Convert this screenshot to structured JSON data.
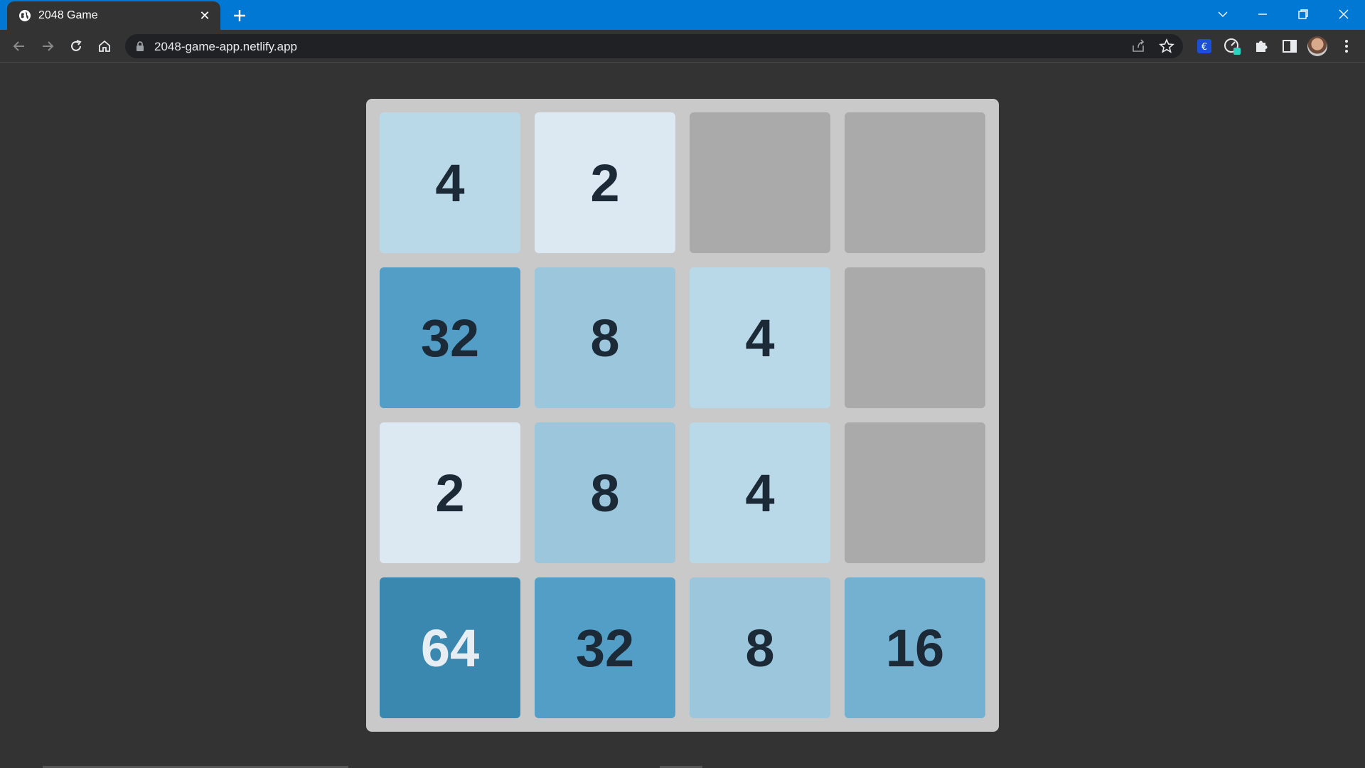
{
  "browser": {
    "tab_title": "2048 Game",
    "url": "2048-game-app.netlify.app",
    "accent_color": "#0078d4",
    "icons": [
      "globe-icon",
      "close-icon",
      "plus-icon",
      "chevron-down-icon",
      "minimize-icon",
      "restore-icon",
      "window-close-icon",
      "back-icon",
      "forward-icon",
      "reload-icon",
      "home-icon",
      "lock-icon",
      "share-icon",
      "star-icon",
      "euro-extension-icon",
      "speed-extension-icon",
      "puzzle-icon",
      "side-panel-icon",
      "profile-avatar",
      "menu-icon"
    ]
  },
  "game": {
    "rows": [
      [
        "4",
        "2",
        "",
        ""
      ],
      [
        "32",
        "8",
        "4",
        ""
      ],
      [
        "2",
        "8",
        "4",
        ""
      ],
      [
        "64",
        "32",
        "8",
        "16"
      ]
    ],
    "colors": {
      "2": "#dde9f2",
      "4": "#b9d9e9",
      "8": "#9bc6dc",
      "16": "#74b0d0",
      "32": "#529ec6",
      "64": "#3a87b0",
      "empty": "#aaaaaa",
      "board": "#c9c9c9"
    }
  }
}
